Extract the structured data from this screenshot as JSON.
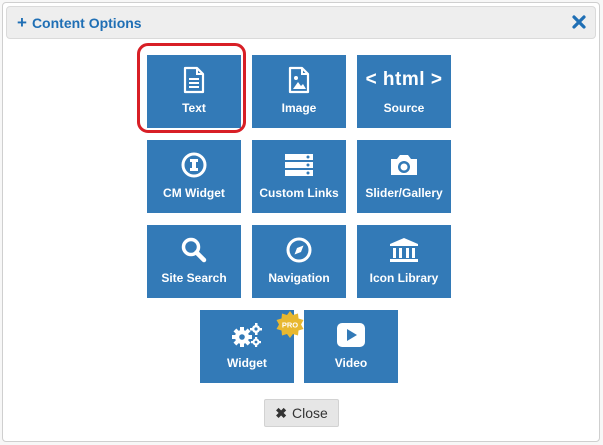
{
  "dialog": {
    "title": "Content Options",
    "plus_glyph": "+",
    "close_icon": "close-icon"
  },
  "tiles": {
    "text": {
      "label": "Text",
      "icon": "document-icon"
    },
    "image": {
      "label": "Image",
      "icon": "image-icon"
    },
    "source": {
      "label": "Source",
      "icon": "html-code-icon",
      "icon_text": "< html >"
    },
    "cm_widget": {
      "label": "CM Widget",
      "icon": "cm-widget-icon"
    },
    "custom_links": {
      "label": "Custom Links",
      "icon": "list-icon"
    },
    "slider": {
      "label": "Slider/Gallery",
      "icon": "camera-icon"
    },
    "site_search": {
      "label": "Site Search",
      "icon": "search-icon"
    },
    "navigation": {
      "label": "Navigation",
      "icon": "compass-icon"
    },
    "icon_library": {
      "label": "Icon Library",
      "icon": "institution-icon"
    },
    "widget": {
      "label": "Widget",
      "icon": "gears-icon",
      "badge": "PRO"
    },
    "video": {
      "label": "Video",
      "icon": "play-icon"
    }
  },
  "footer": {
    "close_label": "Close",
    "close_glyph": "✖"
  },
  "colors": {
    "tile": "#337ab7",
    "title": "#1f6fb5",
    "highlight": "#d81f26",
    "badge": "#e8b830"
  }
}
